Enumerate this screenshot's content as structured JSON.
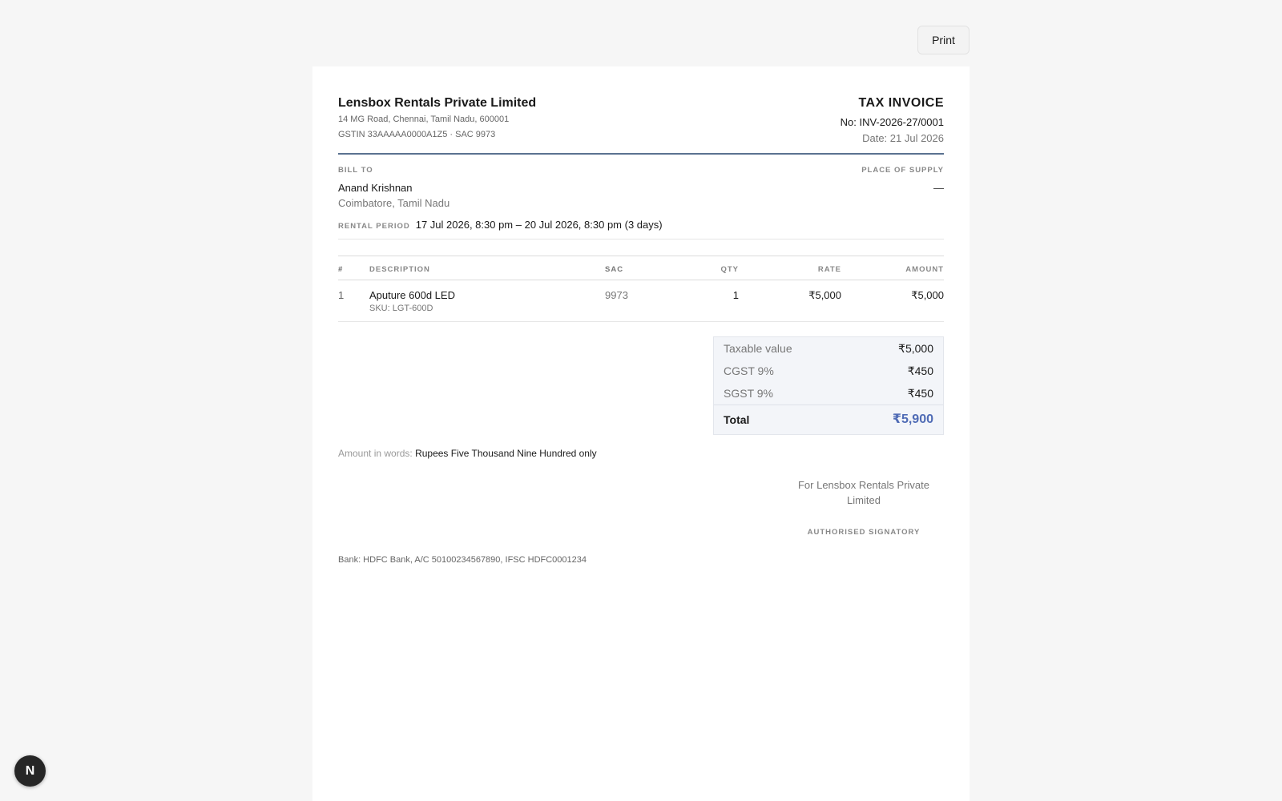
{
  "toolbar": {
    "print_label": "Print"
  },
  "seller": {
    "name": "Lensbox Rentals Private Limited",
    "address": "14 MG Road, Chennai, Tamil Nadu, 600001",
    "gstin_line": "GSTIN 33AAAAA0000A1Z5 · SAC 9973"
  },
  "invoice": {
    "title": "TAX INVOICE",
    "number": "No: INV-2026-27/0001",
    "date": "Date: 21 Jul 2026"
  },
  "bill_to": {
    "label": "BILL TO",
    "name": "Anand Krishnan",
    "city": "Coimbatore, Tamil Nadu"
  },
  "place_of_supply": {
    "label": "PLACE OF SUPPLY",
    "value": "—"
  },
  "rental_period": {
    "label": "RENTAL PERIOD",
    "value": "17 Jul 2026, 8:30 pm – 20 Jul 2026, 8:30 pm (3 days)"
  },
  "items_table": {
    "headers": [
      "#",
      "DESCRIPTION",
      "SAC",
      "QTY",
      "RATE",
      "AMOUNT"
    ],
    "rows": [
      {
        "idx": "1",
        "description": "Aputure 600d LED",
        "sku": "SKU: LGT-600D",
        "sac": "9973",
        "qty": "1",
        "rate": "₹5,000",
        "amount": "₹5,000"
      }
    ]
  },
  "totals": {
    "taxable_label": "Taxable value",
    "taxable_value": "₹5,000",
    "cgst_label": "CGST 9%",
    "cgst_value": "₹450",
    "sgst_label": "SGST 9%",
    "sgst_value": "₹450",
    "total_label": "Total",
    "total_value": "₹5,900"
  },
  "amount_in_words": {
    "label": "Amount in words:",
    "value": "Rupees Five Thousand Nine Hundred only"
  },
  "signatory": {
    "for_line": "For Lensbox Rentals Private Limited",
    "title": "AUTHORISED SIGNATORY"
  },
  "bank": "Bank: HDFC Bank, A/C 50100234567890, IFSC HDFC0001234",
  "dev_badge": {
    "letter": "N"
  },
  "colors": {
    "accent_total": "#4f6bb5",
    "header_rule": "#5b7290",
    "page_bg": "#f6f6f6"
  }
}
